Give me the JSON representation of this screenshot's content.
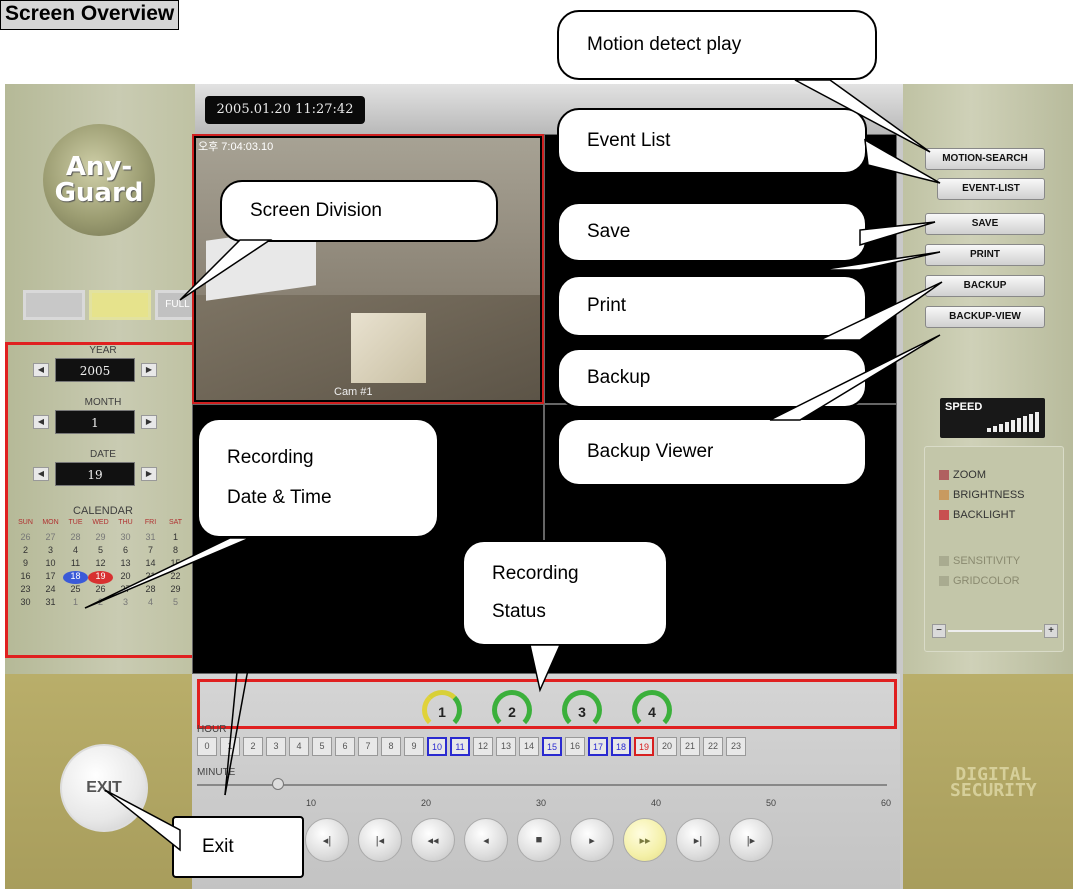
{
  "heading": "Screen Overview",
  "clock": "2005.01.20   11:27:42",
  "logo": {
    "line1": "Any-",
    "line2": "Guard"
  },
  "screen_division": {
    "full_label": "FULL"
  },
  "camera": {
    "stamp": "오후 7:04:03.10",
    "label": "Cam #1"
  },
  "date": {
    "year_label": "YEAR",
    "year": "2005",
    "month_label": "MONTH",
    "month": "1",
    "date_label": "DATE",
    "date": "19",
    "calendar_label": "CALENDAR",
    "weekdays": [
      "SUN",
      "MON",
      "TUE",
      "WED",
      "THU",
      "FRI",
      "SAT"
    ],
    "weeks": [
      [
        "26",
        "27",
        "28",
        "29",
        "30",
        "31",
        "1"
      ],
      [
        "2",
        "3",
        "4",
        "5",
        "6",
        "7",
        "8"
      ],
      [
        "9",
        "10",
        "11",
        "12",
        "13",
        "14",
        "15"
      ],
      [
        "16",
        "17",
        "18",
        "19",
        "20",
        "21",
        "22"
      ],
      [
        "23",
        "24",
        "25",
        "26",
        "27",
        "28",
        "29"
      ],
      [
        "30",
        "31",
        "1",
        "2",
        "3",
        "4",
        "5"
      ]
    ]
  },
  "right_buttons": [
    "MOTION-SEARCH",
    "EVENT-LIST",
    "SAVE",
    "PRINT",
    "BACKUP",
    "BACKUP-VIEW"
  ],
  "speed_label": "SPEED",
  "adjust": {
    "zoom": "ZOOM",
    "brightness": "BRIGHTNESS",
    "backlight": "BACKLIGHT",
    "sensitivity": "SENSITIVITY",
    "gridcolor": "GRIDCOLOR",
    "minus": "−",
    "plus": "+"
  },
  "status_channels": [
    "1",
    "2",
    "3",
    "4"
  ],
  "hour_label": "HOUR",
  "hours": [
    "0",
    "1",
    "2",
    "3",
    "4",
    "5",
    "6",
    "7",
    "8",
    "9",
    "10",
    "11",
    "12",
    "13",
    "14",
    "15",
    "16",
    "17",
    "18",
    "19",
    "20",
    "21",
    "22",
    "23"
  ],
  "recorded_hours": [
    "10",
    "11",
    "15",
    "17",
    "18"
  ],
  "current_hour": "19",
  "minute_label": "MINUTE",
  "minute_ticks": [
    "10",
    "20",
    "30",
    "40",
    "50",
    "60"
  ],
  "minute_value": 7,
  "playback_buttons": [
    "◂|",
    "|◂",
    "◂◂",
    "◂",
    "■",
    "▸",
    "▸▸",
    "▸|",
    "|▸"
  ],
  "exit_label": "EXIT",
  "brand": {
    "line1": "DIGITAL",
    "line2": "SECURITY"
  },
  "callouts": {
    "motion": "Motion detect play",
    "event": "Event List",
    "division": "Screen Division",
    "save": "Save",
    "print": "Print",
    "backup": "Backup",
    "rec_date_1": "Recording",
    "rec_date_2": "Date & Time",
    "backup_viewer": "Backup Viewer",
    "rec_status_1": "Recording",
    "rec_status_2": "Status",
    "exit": "Exit"
  }
}
